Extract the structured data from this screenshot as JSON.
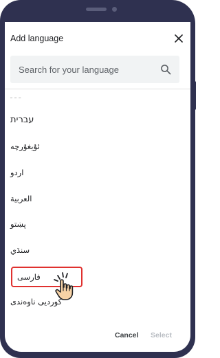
{
  "dialog": {
    "title": "Add language",
    "search_placeholder": "Search for your language",
    "cancel_label": "Cancel",
    "select_label": "Select"
  },
  "languages": [
    {
      "label": "ـ ـ ـ",
      "state": "partial"
    },
    {
      "label": "עברית",
      "state": "normal"
    },
    {
      "label": "ئۇيغۇرچە",
      "state": "normal"
    },
    {
      "label": "اردو",
      "state": "normal"
    },
    {
      "label": "العربية",
      "state": "normal"
    },
    {
      "label": "پښتو",
      "state": "normal"
    },
    {
      "label": "سنڌي",
      "state": "normal"
    },
    {
      "label": "فارسی",
      "state": "selected"
    },
    {
      "label": "کوردیی ناوەندی",
      "state": "normal"
    }
  ],
  "colors": {
    "frame": "#2f3150",
    "highlight": "#e0312f",
    "search_bg": "#f1f3f4",
    "disabled_text": "#b8bcc2"
  },
  "icons": {
    "close": "close-icon",
    "search": "search-icon",
    "pointer": "hand-pointer-icon"
  }
}
